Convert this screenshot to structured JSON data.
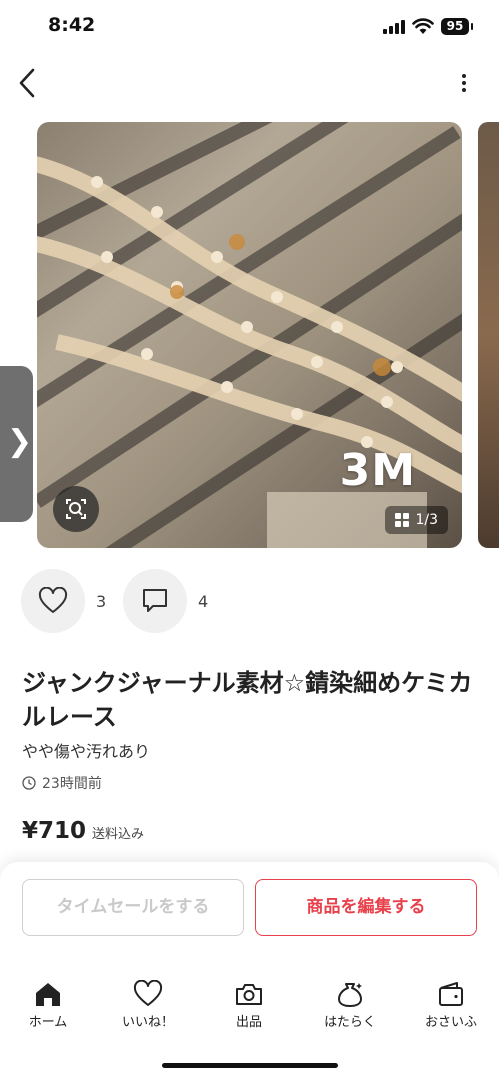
{
  "status": {
    "time": "8:42",
    "battery": "95"
  },
  "photo": {
    "overlay_text": "3M",
    "counter": "1/3"
  },
  "reactions": {
    "likes": "3",
    "comments": "4"
  },
  "item": {
    "title": "ジャンクジャーナル素材☆錆染細めケミカルレース",
    "condition": "やや傷や汚れあり",
    "posted": "23時間前",
    "price": "¥710",
    "shipping": "送料込み"
  },
  "actions": {
    "time_sale": "タイムセールをする",
    "edit": "商品を編集する"
  },
  "tabbar": [
    {
      "label": "ホーム",
      "icon": "home-icon"
    },
    {
      "label": "いいね！",
      "icon": "heart-icon"
    },
    {
      "label": "出品",
      "icon": "camera-icon"
    },
    {
      "label": "はたらく",
      "icon": "money-bag-icon"
    },
    {
      "label": "おさいふ",
      "icon": "wallet-icon"
    }
  ],
  "colors": {
    "accent": "#e8414b",
    "disabled": "#c9c9c9"
  }
}
